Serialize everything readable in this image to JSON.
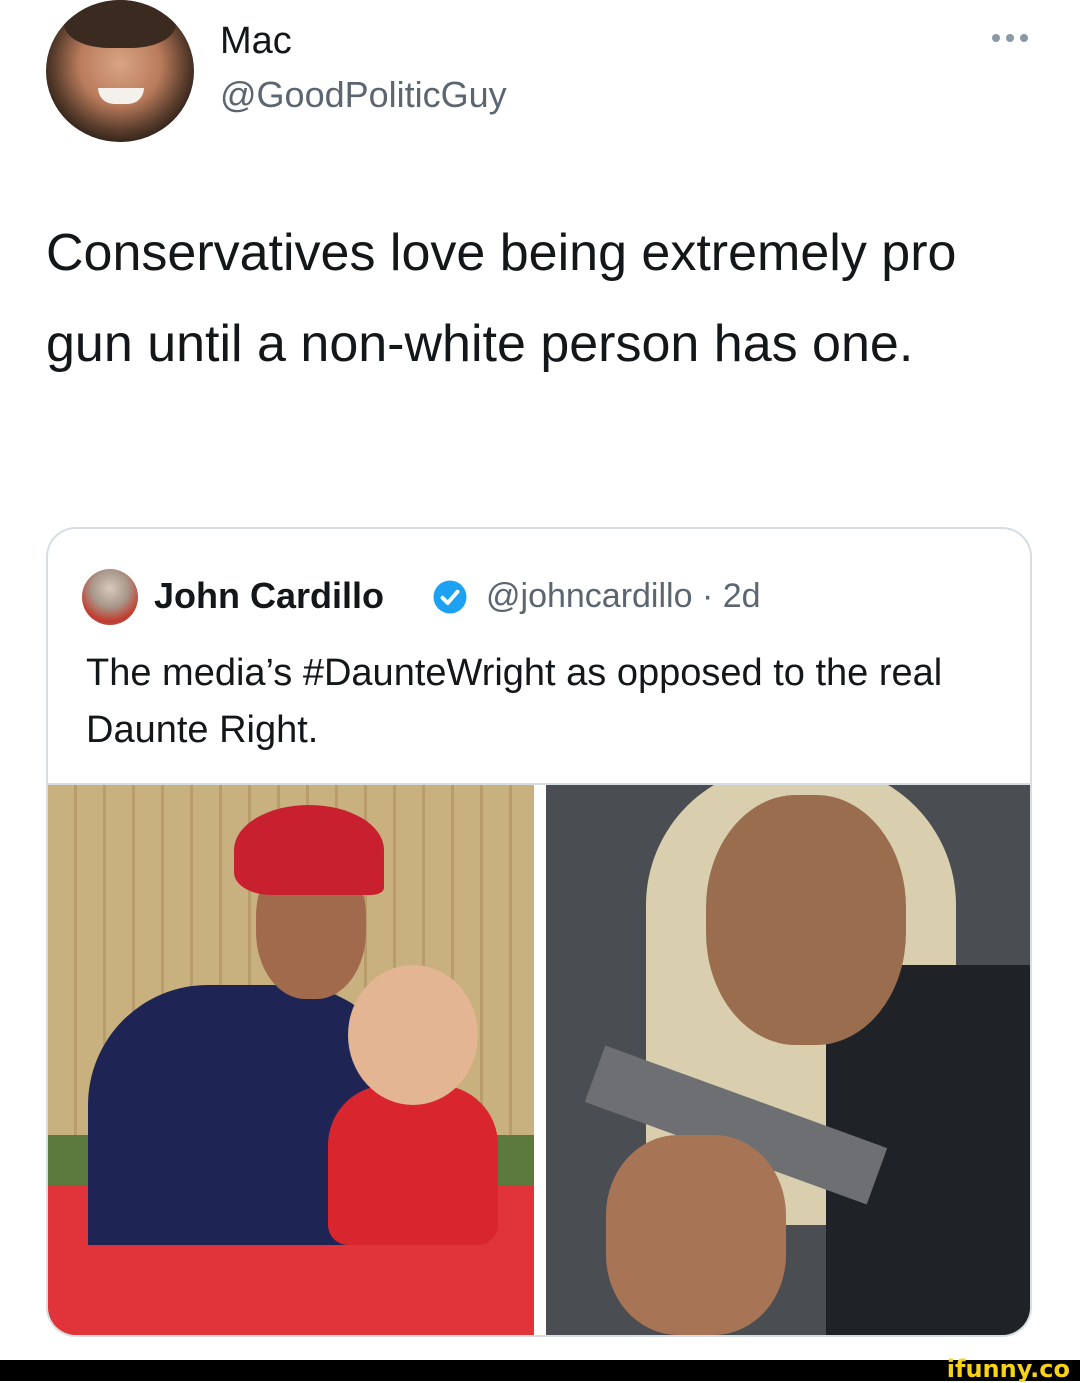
{
  "tweet": {
    "author_name": "Mac",
    "author_handle": "@GoodPoliticGuy",
    "text": "Conservatives love being extremely pro gun until a non-white person has one."
  },
  "quoted_tweet": {
    "author_name": "John Cardillo",
    "author_handle_time": "@johncardillo · 2d",
    "text": "The media’s #DaunteWright as opposed to the real Daunte Right."
  },
  "watermark": "ifunny.co",
  "colors": {
    "text_primary": "#14171a",
    "text_secondary": "#5b6670",
    "verified_blue": "#1da1f2",
    "border": "#d6dde3",
    "watermark": "#f7d316"
  },
  "icons": {
    "more": "more-horizontal-icon",
    "verified": "verified-badge-icon"
  }
}
